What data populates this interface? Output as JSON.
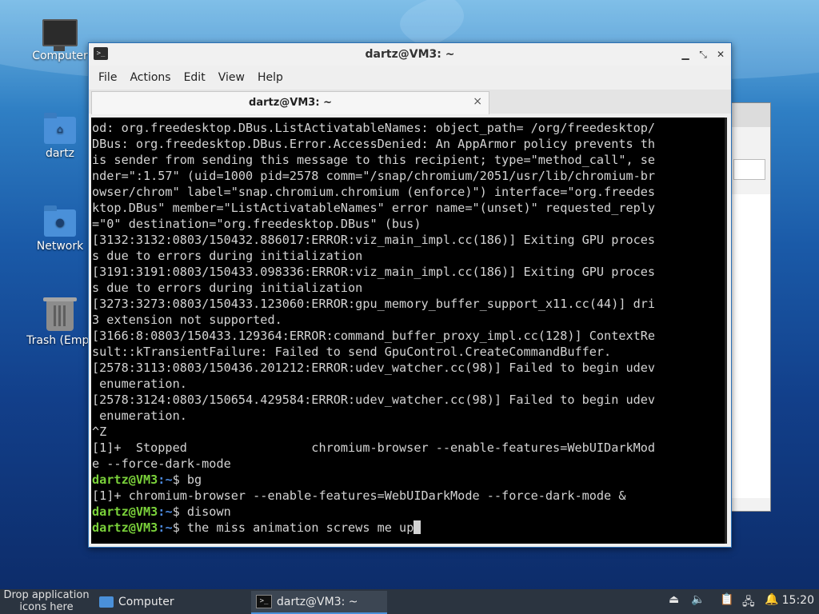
{
  "desktop": {
    "icons": [
      {
        "label": "Computer",
        "icon": "computer-icon"
      },
      {
        "label": "dartz",
        "icon": "home-folder-icon"
      },
      {
        "label": "Network",
        "icon": "network-folder-icon"
      },
      {
        "label": "Trash (Empt",
        "icon": "trash-icon"
      }
    ]
  },
  "window": {
    "title": "dartz@VM3: ~",
    "menu": [
      "File",
      "Actions",
      "Edit",
      "View",
      "Help"
    ],
    "tab_label": "dartz@VM3: ~",
    "close_glyph": "×"
  },
  "terminal": {
    "lines": [
      "od: org.freedesktop.DBus.ListActivatableNames: object_path= /org/freedesktop/",
      "DBus: org.freedesktop.DBus.Error.AccessDenied: An AppArmor policy prevents th",
      "is sender from sending this message to this recipient; type=\"method_call\", se",
      "nder=\":1.57\" (uid=1000 pid=2578 comm=\"/snap/chromium/2051/usr/lib/chromium-br",
      "owser/chrom\" label=\"snap.chromium.chromium (enforce)\") interface=\"org.freedes",
      "ktop.DBus\" member=\"ListActivatableNames\" error name=\"(unset)\" requested_reply",
      "=\"0\" destination=\"org.freedesktop.DBus\" (bus)",
      "[3132:3132:0803/150432.886017:ERROR:viz_main_impl.cc(186)] Exiting GPU proces",
      "s due to errors during initialization",
      "[3191:3191:0803/150433.098336:ERROR:viz_main_impl.cc(186)] Exiting GPU proces",
      "s due to errors during initialization",
      "[3273:3273:0803/150433.123060:ERROR:gpu_memory_buffer_support_x11.cc(44)] dri",
      "3 extension not supported.",
      "[3166:8:0803/150433.129364:ERROR:command_buffer_proxy_impl.cc(128)] ContextRe",
      "sult::kTransientFailure: Failed to send GpuControl.CreateCommandBuffer.",
      "[2578:3113:0803/150436.201212:ERROR:udev_watcher.cc(98)] Failed to begin udev",
      " enumeration.",
      "[2578:3124:0803/150654.429584:ERROR:udev_watcher.cc(98)] Failed to begin udev",
      " enumeration.",
      "^Z",
      "[1]+  Stopped                 chromium-browser --enable-features=WebUIDarkMod",
      "e --force-dark-mode"
    ],
    "user": "dartz@VM3",
    "path": ":~",
    "prompt_char": "$",
    "cmd1": " bg",
    "out1": "[1]+ chromium-browser --enable-features=WebUIDarkMode --force-dark-mode &",
    "cmd2": " disown",
    "cmd3": " the miss animation screws me up"
  },
  "taskbar": {
    "drop_text": "Drop application icons here",
    "tasks": [
      "Computer",
      "dartz@VM3: ~"
    ],
    "clock": "15:20"
  },
  "colors": {
    "prompt_user": "#7ad13a",
    "prompt_path": "#4d8be0",
    "accent": "#4a90d9"
  }
}
